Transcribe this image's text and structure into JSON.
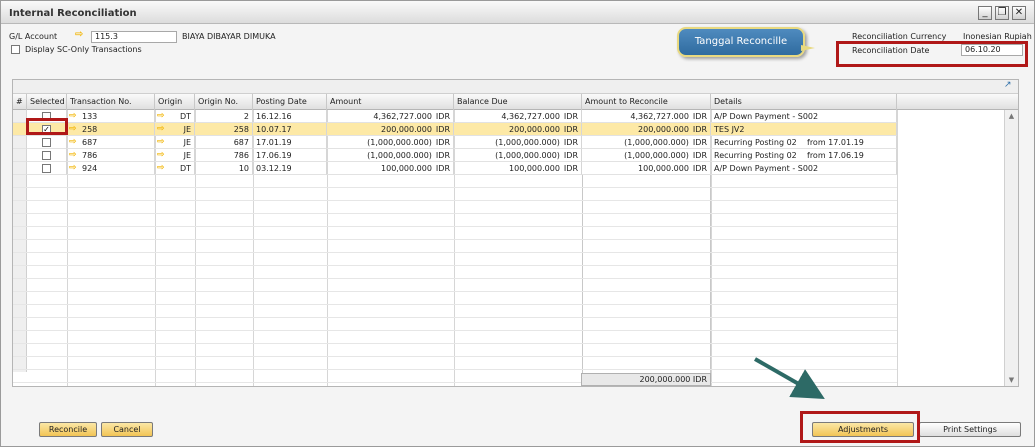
{
  "window": {
    "title": "Internal Reconciliation",
    "buttons": [
      "_",
      "❐",
      "✕"
    ]
  },
  "header": {
    "gl_account_label": "G/L Account",
    "gl_account_value": "115.3",
    "gl_account_name": "BIAYA DIBAYAR DIMUKA",
    "display_sc_label": "Display SC-Only Transactions",
    "currency_label": "Reconciliation Currency",
    "currency_value": "Inonesian Rupiah",
    "date_label": "Reconciliation Date",
    "date_value": "06.10.20"
  },
  "callout": {
    "text": "Tanggal Reconcille",
    "color": "#2f6b9f"
  },
  "grid": {
    "columns": [
      "#",
      "Selected",
      "Transaction No.",
      "Origin",
      "Origin No.",
      "Posting Date",
      "Amount",
      "Balance Due",
      "Amount to Reconcile",
      "Details"
    ],
    "currency": "IDR",
    "rows": [
      {
        "num": "",
        "selected": false,
        "transaction_no": "133",
        "origin": "DT",
        "origin_no": "2",
        "posting_date": "16.12.16",
        "amount": "4,362,727.000",
        "balance_due": "4,362,727.000",
        "amount_to_reconcile": "4,362,727.000",
        "details": "A/P Down Payment - S002",
        "details_extra": ""
      },
      {
        "num": "",
        "selected": true,
        "transaction_no": "258",
        "origin": "JE",
        "origin_no": "258",
        "posting_date": "10.07.17",
        "amount": "200,000.000",
        "balance_due": "200,000.000",
        "amount_to_reconcile": "200,000.000",
        "details": "TES JV2",
        "details_extra": ""
      },
      {
        "num": "",
        "selected": false,
        "transaction_no": "687",
        "origin": "JE",
        "origin_no": "687",
        "posting_date": "17.01.19",
        "amount": "(1,000,000.000)",
        "balance_due": "(1,000,000.000)",
        "amount_to_reconcile": "(1,000,000.000)",
        "details": "Recurring Posting 02",
        "details_extra": "from 17.01.19"
      },
      {
        "num": "",
        "selected": false,
        "transaction_no": "786",
        "origin": "JE",
        "origin_no": "786",
        "posting_date": "17.06.19",
        "amount": "(1,000,000.000)",
        "balance_due": "(1,000,000.000)",
        "amount_to_reconcile": "(1,000,000.000)",
        "details": "Recurring Posting 02",
        "details_extra": "from 17.06.19"
      },
      {
        "num": "",
        "selected": false,
        "transaction_no": "924",
        "origin": "DT",
        "origin_no": "10",
        "posting_date": "03.12.19",
        "amount": "100,000.000",
        "balance_due": "100,000.000",
        "amount_to_reconcile": "100,000.000",
        "details": "A/P Down Payment - S002",
        "details_extra": ""
      }
    ],
    "total_amount_to_reconcile": "200,000.000 IDR"
  },
  "footer": {
    "reconcile_label": "Reconcile",
    "cancel_label": "Cancel",
    "adjustments_label": "Adjustments",
    "print_settings_label": "Print Settings"
  },
  "colors": {
    "highlight_red": "#b01818",
    "selected_row": "#fde9a6",
    "button_gold": "#f2c455",
    "link_arrow": "#f2b400",
    "annotation_arrow": "#2d6a66"
  }
}
